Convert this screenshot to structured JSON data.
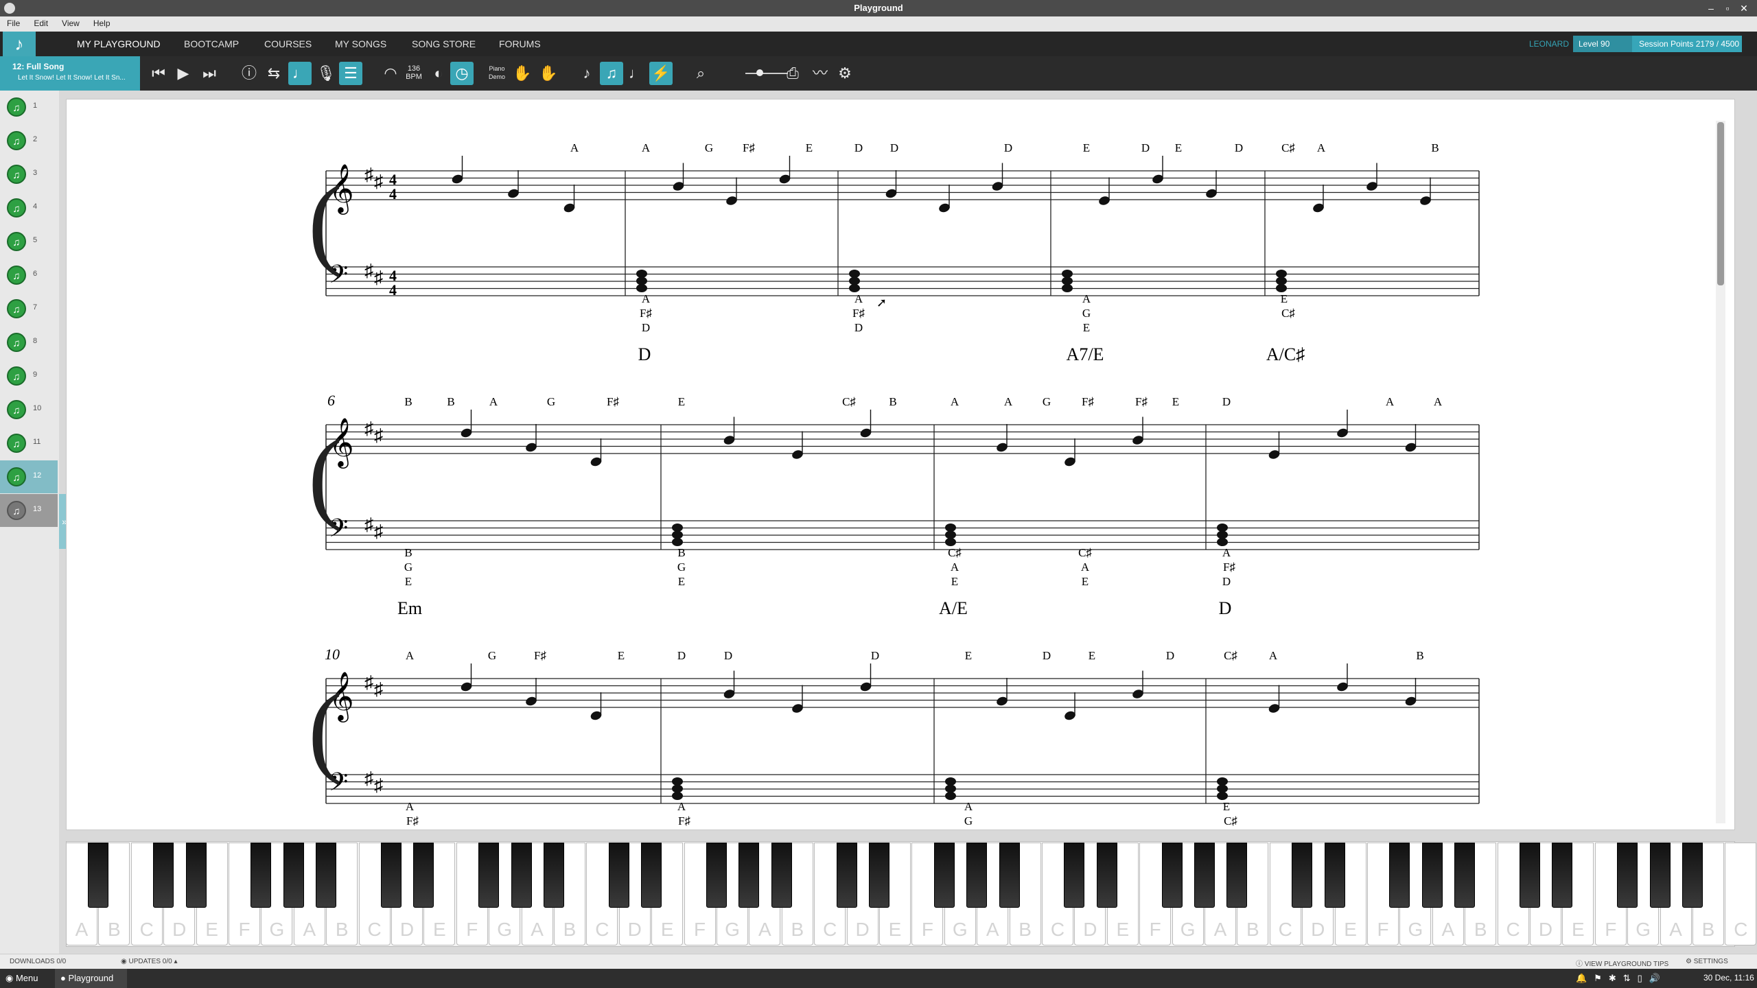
{
  "window": {
    "title": "Playground"
  },
  "menu": [
    "File",
    "Edit",
    "View",
    "Help"
  ],
  "nav": {
    "items": [
      "MY PLAYGROUND",
      "BOOTCAMP",
      "COURSES",
      "MY SONGS",
      "SONG STORE",
      "FORUMS"
    ],
    "user": "LEONARD",
    "level": "Level 90",
    "session_points": "Session Points 2179 / 4500"
  },
  "song": {
    "title": "12: Full Song",
    "subtitle": "Let It Snow! Let It Snow! Let It Sn..."
  },
  "toolbar": {
    "tempo_value": "136",
    "tempo_unit": "BPM",
    "piano_demo_1": "Piano",
    "piano_demo_2": "Demo"
  },
  "sections": [
    "1",
    "2",
    "3",
    "4",
    "5",
    "6",
    "7",
    "8",
    "9",
    "10",
    "11",
    "12",
    "13"
  ],
  "score": {
    "systems": [
      {
        "measure_number": "",
        "top_letters": [
          "A",
          "A",
          "G",
          "F♯",
          "E",
          "D",
          "D",
          "D",
          "E",
          "D",
          "E",
          "D",
          "C♯",
          "A",
          "B"
        ],
        "bottom_letters": [
          [
            "A",
            "F♯",
            "D"
          ],
          [
            "A",
            "F♯",
            "D"
          ],
          [
            "A",
            "G",
            "E"
          ],
          [
            "E",
            "C♯"
          ]
        ],
        "chords": [
          "D",
          "A7/E",
          "A/C♯"
        ]
      },
      {
        "measure_number": "6",
        "top_letters": [
          "B",
          "B",
          "A",
          "G",
          "F♯",
          "E",
          "C♯",
          "B",
          "A",
          "A",
          "G",
          "F♯",
          "F♯",
          "E",
          "D",
          "A",
          "A"
        ],
        "bottom_letters": [
          [
            "B",
            "G",
            "E"
          ],
          [
            "B",
            "G",
            "E"
          ],
          [
            "C♯",
            "A",
            "E"
          ],
          [
            "C♯",
            "A",
            "E"
          ],
          [
            "A",
            "F♯",
            "D"
          ]
        ],
        "chords": [
          "Em",
          "A/E",
          "D"
        ]
      },
      {
        "measure_number": "10",
        "top_letters": [
          "A",
          "G",
          "F♯",
          "E",
          "D",
          "D",
          "D",
          "E",
          "D",
          "E",
          "D",
          "C♯",
          "A",
          "B"
        ],
        "bottom_letters": [
          [
            "A",
            "F♯"
          ],
          [
            "A",
            "F♯"
          ],
          [
            "A",
            "G"
          ],
          [
            "E",
            "C♯"
          ]
        ],
        "chords": []
      }
    ]
  },
  "keyboard": {
    "white_keys": [
      "A",
      "B",
      "C",
      "D",
      "E",
      "F",
      "G",
      "A",
      "B",
      "C",
      "D",
      "E",
      "F",
      "G",
      "A",
      "B",
      "C",
      "D",
      "E",
      "F",
      "G",
      "A",
      "B",
      "C",
      "D",
      "E",
      "F",
      "G",
      "A",
      "B",
      "C",
      "D",
      "E",
      "F",
      "G",
      "A",
      "B",
      "C",
      "D",
      "E",
      "F",
      "G",
      "A",
      "B",
      "C",
      "D",
      "E",
      "F",
      "G",
      "A",
      "B",
      "C"
    ]
  },
  "status": {
    "downloads": "DOWNLOADS 0/0",
    "updates": "UPDATES 0/0",
    "tips": "VIEW PLAYGROUND TIPS",
    "settings": "SETTINGS"
  },
  "taskbar": {
    "menu": "Menu",
    "app": "Playground",
    "clock": "30 Dec, 11:16"
  }
}
